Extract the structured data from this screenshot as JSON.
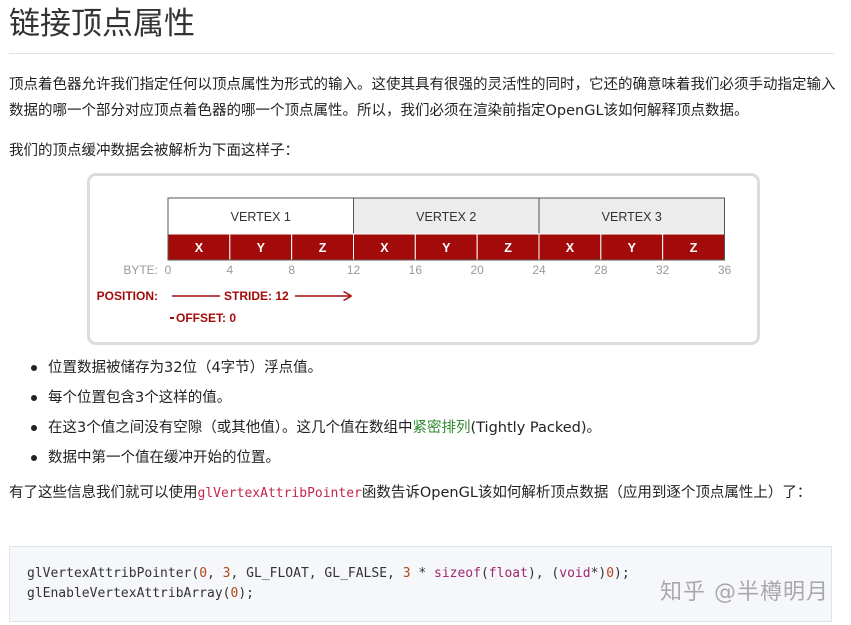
{
  "page": {
    "title": "链接顶点属性",
    "intro": "顶点着色器允许我们指定任何以顶点属性为形式的输入。这使其具有很强的灵活性的同时，它还的确意味着我们必须手动指定输入数据的哪一个部分对应顶点着色器的哪一个顶点属性。所以，我们必须在渲染前指定OpenGL该如何解释顶点数据。",
    "parse_intro": "我们的顶点缓冲数据会被解析为下面这样子：",
    "bullets": [
      "位置数据被储存为32位（4字节）浮点值。",
      "每个位置包含3个这样的值。",
      "在这3个值之间没有空隙（或其他值）。这几个值在数组中",
      "数据中第一个值在缓冲开始的位置。"
    ],
    "bullet3_link": "紧密排列",
    "bullet3_suffix": "(Tightly Packed)。",
    "outro_before": "有了这些信息我们就可以使用",
    "outro_code": "glVertexAttribPointer",
    "outro_after": "函数告诉OpenGL该如何解析顶点数据（应用到逐个顶点属性上）了：",
    "code_lines": [
      "glVertexAttribPointer(0, 3, GL_FLOAT, GL_FALSE, 3 * sizeof(float), (void*)0);",
      "glEnableVertexAttribArray(0);"
    ],
    "watermark": "知乎 @半樽明月"
  },
  "diagram": {
    "vertices": [
      "VERTEX 1",
      "VERTEX 2",
      "VERTEX 3"
    ],
    "components": [
      "X",
      "Y",
      "Z"
    ],
    "byte_label": "BYTE:",
    "bytes": [
      "0",
      "4",
      "8",
      "12",
      "16",
      "20",
      "24",
      "28",
      "32",
      "36"
    ],
    "position_label": "POSITION:",
    "stride_label": "STRIDE: 12",
    "offset_label": "OFFSET: 0",
    "colors": {
      "accent": "#a30b0b",
      "header_fill": "#ececec",
      "header_fill_first": "#ffffff",
      "tick_text": "#9a9a9a"
    }
  }
}
